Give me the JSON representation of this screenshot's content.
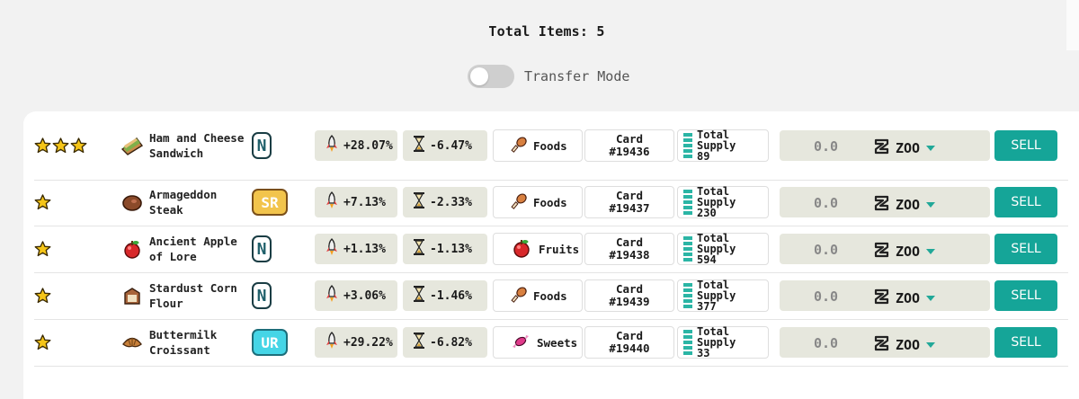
{
  "header": {
    "total_label": "Total Items: 5",
    "transfer_mode_label": "Transfer Mode",
    "transfer_mode_on": false
  },
  "colors": {
    "accent": "#15a598",
    "stat_bg": "#e6e7dd",
    "star": "#f5c518"
  },
  "items": [
    {
      "stars": 3,
      "name": "Ham and Cheese Sandwich",
      "icon": "sandwich-icon",
      "rarity": "N",
      "boost": "+28.07%",
      "time": "-6.47%",
      "category": "Foods",
      "category_icon": "drumstick-icon",
      "card_label": "Card",
      "card_no": "#19436",
      "supply_label": "Total Supply",
      "supply": "89",
      "price": "0.0",
      "currency": "ZOO",
      "sell": "SELL"
    },
    {
      "stars": 1,
      "name": "Armageddon Steak",
      "icon": "steak-icon",
      "rarity": "SR",
      "boost": "+7.13%",
      "time": "-2.33%",
      "category": "Foods",
      "category_icon": "drumstick-icon",
      "card_label": "Card",
      "card_no": "#19437",
      "supply_label": "Total Supply",
      "supply": "230",
      "price": "0.0",
      "currency": "ZOO",
      "sell": "SELL"
    },
    {
      "stars": 1,
      "name": "Ancient Apple of Lore",
      "icon": "apple-icon",
      "rarity": "N",
      "boost": "+1.13%",
      "time": "-1.13%",
      "category": "Fruits",
      "category_icon": "apple-icon",
      "card_label": "Card",
      "card_no": "#19438",
      "supply_label": "Total Supply",
      "supply": "594",
      "price": "0.0",
      "currency": "ZOO",
      "sell": "SELL"
    },
    {
      "stars": 1,
      "name": "Stardust Corn Flour",
      "icon": "flour-sack-icon",
      "rarity": "N",
      "boost": "+3.06%",
      "time": "-1.46%",
      "category": "Foods",
      "category_icon": "drumstick-icon",
      "card_label": "Card",
      "card_no": "#19439",
      "supply_label": "Total Supply",
      "supply": "377",
      "price": "0.0",
      "currency": "ZOO",
      "sell": "SELL"
    },
    {
      "stars": 1,
      "name": "Buttermilk Croissant",
      "icon": "croissant-icon",
      "rarity": "UR",
      "boost": "+29.22%",
      "time": "-6.82%",
      "category": "Sweets",
      "category_icon": "candy-icon",
      "card_label": "Card",
      "card_no": "#19440",
      "supply_label": "Total Supply",
      "supply": "33",
      "price": "0.0",
      "currency": "ZOO",
      "sell": "SELL"
    }
  ]
}
